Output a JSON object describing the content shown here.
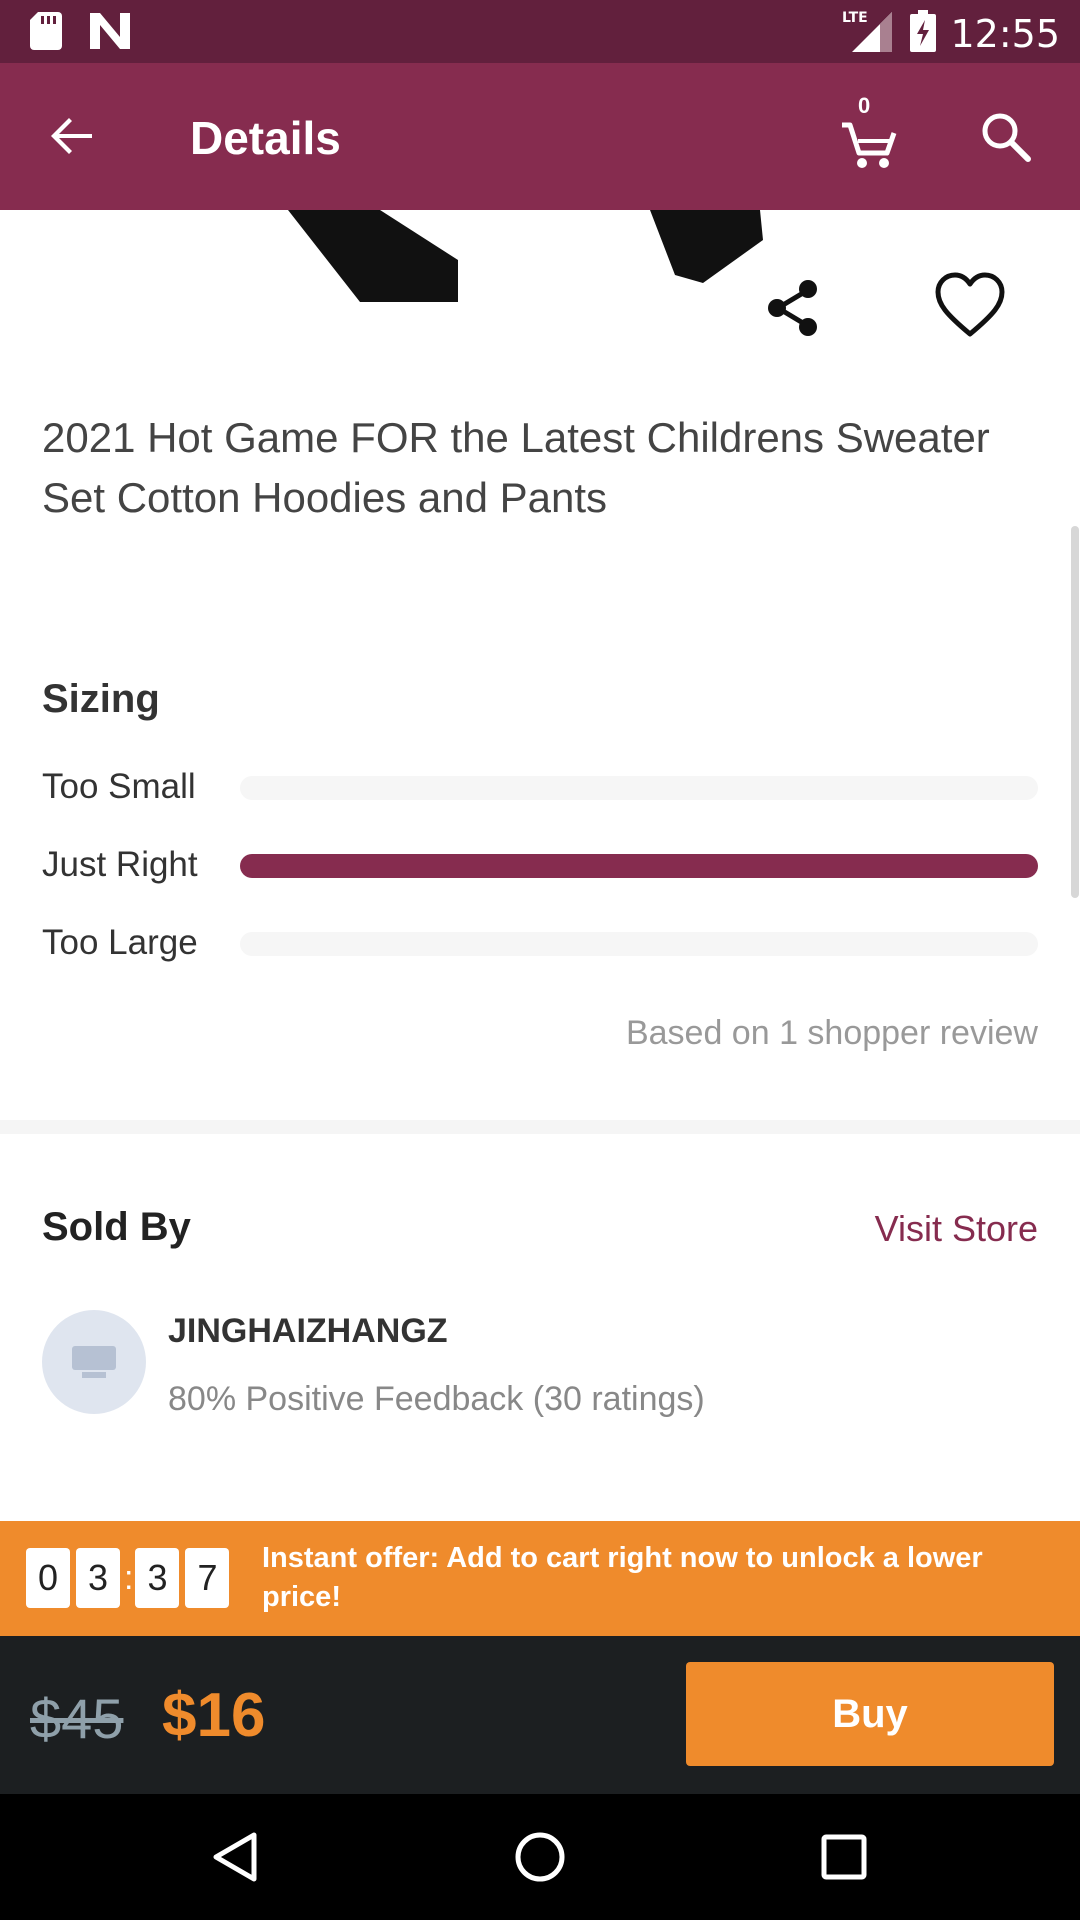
{
  "status_bar": {
    "time": "12:55",
    "network": "LTE",
    "icons": [
      "sd-card-icon",
      "n-notification-icon",
      "lte-signal-icon",
      "battery-charging-icon"
    ]
  },
  "app_bar": {
    "title": "Details",
    "cart_count": "0",
    "icons": [
      "back-arrow-icon",
      "cart-icon",
      "search-icon"
    ]
  },
  "product": {
    "title": "2021 Hot Game FOR the Latest Childrens Sweater Set Cotton Hoodies and Pants",
    "icons": [
      "share-icon",
      "heart-icon"
    ]
  },
  "sizing": {
    "title": "Sizing",
    "rows": [
      {
        "label": "Too Small",
        "fraction": 0.0
      },
      {
        "label": "Just Right",
        "fraction": 1.0
      },
      {
        "label": "Too Large",
        "fraction": 0.0
      }
    ],
    "note": "Based on 1 shopper review"
  },
  "sold_by": {
    "title": "Sold By",
    "visit_store": "Visit Store",
    "store_name": "JINGHAIZHANGZ",
    "feedback": "80% Positive Feedback (30 ratings)"
  },
  "offer": {
    "timer_digits": [
      "0",
      "3",
      "3",
      "7"
    ],
    "text": "Instant offer: Add to cart right now to unlock a lower price!"
  },
  "buy_bar": {
    "old_price": "$45",
    "new_price": "$16",
    "buy_label": "Buy"
  },
  "colors": {
    "status_bar": "#62203d",
    "brand": "#862c4f",
    "accent": "#ef8b2c",
    "buy_bar": "#1c1f21"
  }
}
